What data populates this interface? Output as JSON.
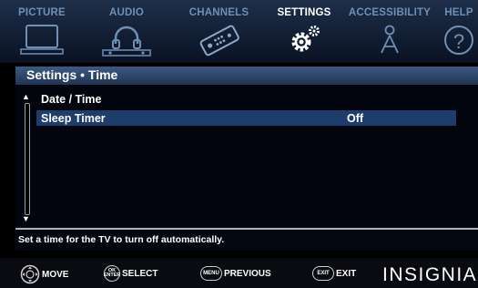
{
  "tabs": [
    {
      "label": "PICTURE",
      "icon": "tv-icon",
      "active": false
    },
    {
      "label": "AUDIO",
      "icon": "headphones-icon",
      "active": false
    },
    {
      "label": "CHANNELS",
      "icon": "remote-icon",
      "active": false
    },
    {
      "label": "SETTINGS",
      "icon": "gears-icon",
      "active": true
    },
    {
      "label": "ACCESSIBILITY",
      "icon": "person-icon",
      "active": false
    },
    {
      "label": "HELP",
      "icon": "help-icon",
      "active": false
    }
  ],
  "breadcrumb": "Settings • Time",
  "items": [
    {
      "label": "Date / Time",
      "value": "",
      "selected": false
    },
    {
      "label": "Sleep Timer",
      "value": "Off",
      "selected": true
    }
  ],
  "hint": "Set a time for the TV to turn off automatically.",
  "bottom_nav": [
    {
      "label": "MOVE",
      "icon": "dpad-icon"
    },
    {
      "label": "SELECT",
      "button_text": "OK ENTER",
      "icon": "ok-enter-icon"
    },
    {
      "label": "PREVIOUS",
      "button_text": "MENU",
      "icon": "menu-button-icon"
    },
    {
      "label": "EXIT",
      "button_text": "EXIT",
      "icon": "exit-button-icon"
    }
  ],
  "brand": "INSIGNIA",
  "colors": {
    "active_tab": "#ffffff",
    "inactive_tab": "#6f8fb5",
    "selected_row": "#1d3d6b",
    "title_bar": "#2f4a70"
  }
}
